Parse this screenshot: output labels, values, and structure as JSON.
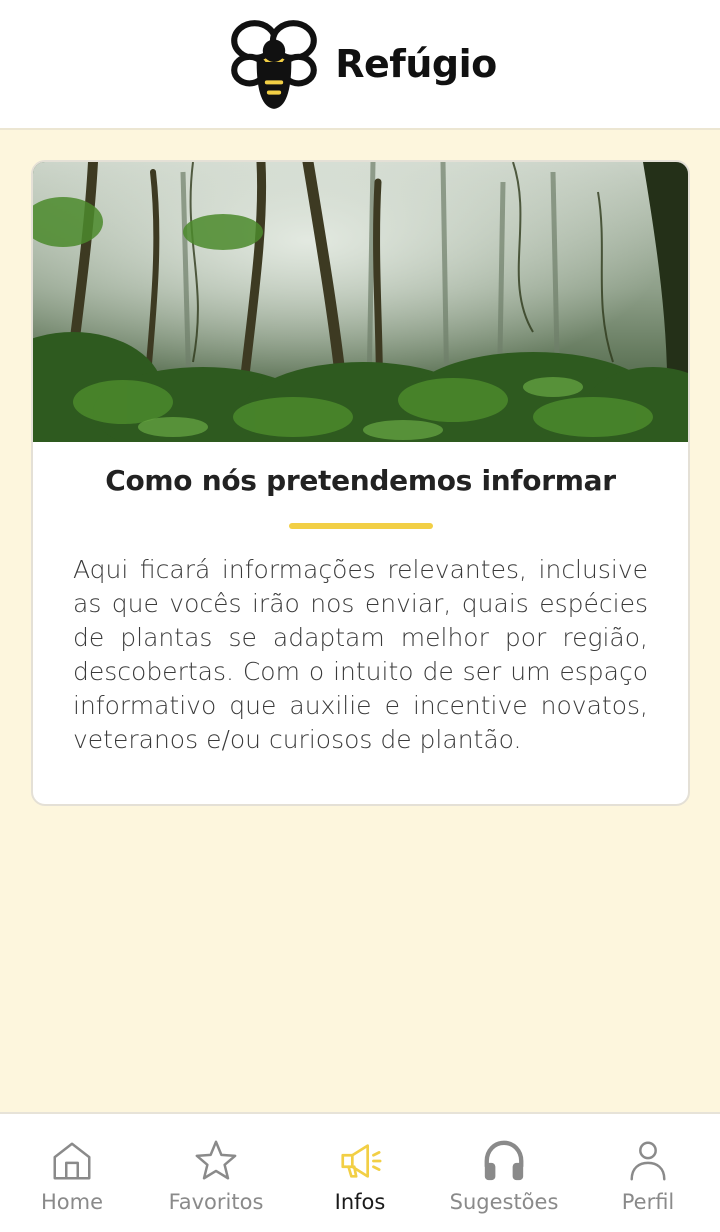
{
  "header": {
    "app_name": "Refúgio",
    "logo_icon": "bee-logo-icon"
  },
  "card": {
    "image": "misty-rainforest-photo",
    "title": "Como nós pretendemos informar",
    "text": "Aqui ficará informações relevantes, inclusive as que vocês irão nos enviar, quais espécies de plantas se adaptam melhor por região, descobertas. Com o intuito de ser um espaço informativo que auxilie e incentive novatos, veteranos e/ou curiosos de plantão."
  },
  "nav": {
    "items": [
      {
        "label": "Home",
        "icon": "home-icon"
      },
      {
        "label": "Favoritos",
        "icon": "star-icon"
      },
      {
        "label": "Infos",
        "icon": "megaphone-icon",
        "active": true
      },
      {
        "label": "Sugestões",
        "icon": "headphones-icon"
      },
      {
        "label": "Perfil",
        "icon": "user-icon"
      }
    ]
  },
  "colors": {
    "accent": "#f2cf45",
    "background": "#fdf6dd",
    "active_icon": "#f2cf45",
    "inactive": "#8a8a8a"
  }
}
